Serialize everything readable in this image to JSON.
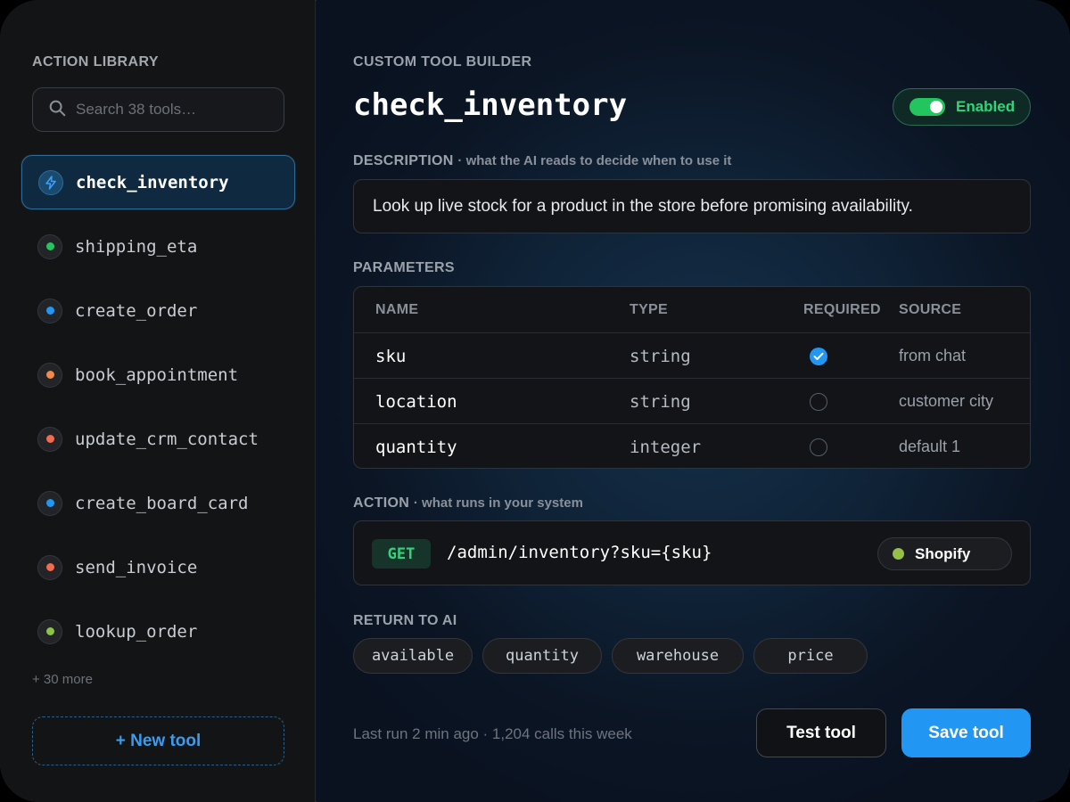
{
  "sidebar": {
    "heading": "ACTION LIBRARY",
    "search_placeholder": "Search 38 tools…",
    "tools": [
      {
        "label": "check_inventory",
        "icon": "lightning-icon",
        "color": "#3aa0ff",
        "active": true
      },
      {
        "label": "shipping_eta",
        "icon": "status-dot",
        "color": "#22c55e"
      },
      {
        "label": "create_order",
        "icon": "status-dot",
        "color": "#2196f3"
      },
      {
        "label": "book_appointment",
        "icon": "status-dot",
        "color": "#f08a4b"
      },
      {
        "label": "update_crm_contact",
        "icon": "status-dot",
        "color": "#f26b4f"
      },
      {
        "label": "create_board_card",
        "icon": "status-dot",
        "color": "#2196f3"
      },
      {
        "label": "send_invoice",
        "icon": "status-dot",
        "color": "#f26b4f"
      },
      {
        "label": "lookup_order",
        "icon": "status-dot",
        "color": "#8bc34a"
      }
    ],
    "more_label": "+ 30 more",
    "new_tool_label": "+ New tool"
  },
  "main": {
    "heading": "CUSTOM TOOL BUILDER",
    "tool_name": "check_inventory",
    "toggle_label": "Enabled",
    "toggle_on": true,
    "description": {
      "label": "DESCRIPTION",
      "sublabel": "· what the AI reads to decide when to use it",
      "text": "Look up live stock for a product in the store before promising availability."
    },
    "parameters": {
      "label": "PARAMETERS",
      "columns": [
        "NAME",
        "TYPE",
        "REQUIRED",
        "SOURCE"
      ],
      "rows": [
        {
          "name": "sku",
          "type": "string",
          "required": true,
          "source": "from chat"
        },
        {
          "name": "location",
          "type": "string",
          "required": false,
          "source": "customer city"
        },
        {
          "name": "quantity",
          "type": "integer",
          "required": false,
          "source": "default 1"
        }
      ]
    },
    "action": {
      "label": "ACTION",
      "sublabel": "· what runs in your system",
      "method": "GET",
      "endpoint": "/admin/inventory?sku={sku}",
      "integration": "Shopify",
      "integration_color": "#95bf47"
    },
    "return_to_ai": {
      "label": "RETURN TO AI",
      "fields": [
        "available",
        "quantity",
        "warehouse",
        "price"
      ]
    },
    "footer": {
      "stat": "Last run 2 min ago · 1,204 calls this week",
      "test_label": "Test tool",
      "save_label": "Save tool"
    }
  },
  "colors": {
    "accent": "#2196f3",
    "success": "#22c55e"
  }
}
